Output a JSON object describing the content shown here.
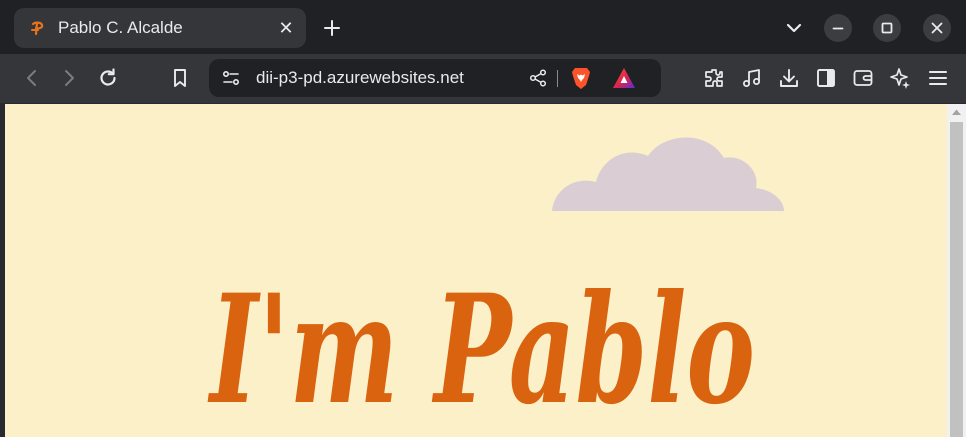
{
  "tab": {
    "title": "Pablo C. Alcalde",
    "close_glyph": "✕",
    "favicon": "pablo-favicon-icon"
  },
  "toolbar": {
    "url": "dii-p3-pd.azurewebsites.net"
  },
  "page": {
    "headline": "I'm Pablo",
    "background_color": "#fbf0c8",
    "headline_color": "#d9630f",
    "cloud_color": "#dacdd3"
  },
  "icons": {
    "back": "back-arrow-icon",
    "forward": "forward-arrow-icon",
    "reload": "reload-icon",
    "bookmark": "bookmark-icon",
    "site_info": "site-settings-icon",
    "share": "share-icon",
    "brave_shields": "brave-shields-icon",
    "brave_rewards": "brave-rewards-icon",
    "extensions": "extensions-icon",
    "media": "music-note-icon",
    "downloads": "download-icon",
    "sidebar": "sidebar-icon",
    "wallet": "wallet-icon",
    "leo": "leo-ai-icon",
    "menu": "hamburger-menu-icon"
  }
}
